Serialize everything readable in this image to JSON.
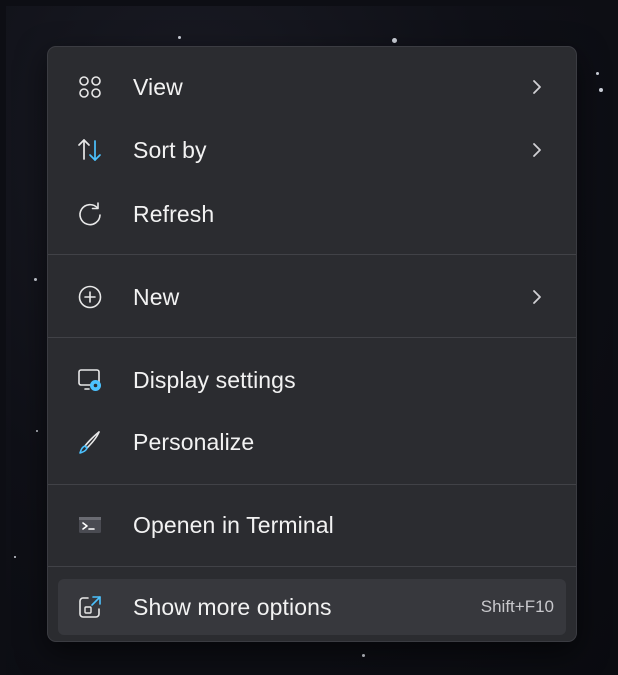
{
  "menu": {
    "items": [
      {
        "label": "View",
        "icon": "grid-icon",
        "has_submenu": true
      },
      {
        "label": "Sort by",
        "icon": "sort-arrows-icon",
        "has_submenu": true
      },
      {
        "label": "Refresh",
        "icon": "refresh-icon",
        "has_submenu": false
      },
      {
        "label": "New",
        "icon": "plus-circle-icon",
        "has_submenu": true
      },
      {
        "label": "Display settings",
        "icon": "display-settings-icon",
        "has_submenu": false
      },
      {
        "label": "Personalize",
        "icon": "brush-icon",
        "has_submenu": false
      },
      {
        "label": "Openen in Terminal",
        "icon": "terminal-icon",
        "has_submenu": false
      },
      {
        "label": "Show more options",
        "icon": "share-box-icon",
        "has_submenu": false,
        "shortcut": "Shift+F10"
      }
    ]
  },
  "colors": {
    "menu_background": "#2b2c30",
    "hover_background": "#37383d",
    "text": "#f2f2f2",
    "accent_blue": "#4cc2ff"
  }
}
